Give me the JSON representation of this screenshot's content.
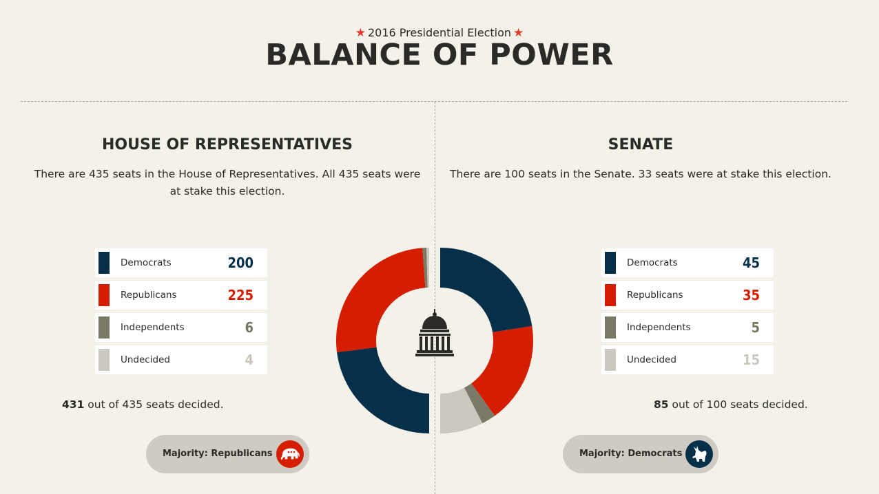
{
  "header": {
    "subtitle": "2016 Presidential Election",
    "title": "BALANCE OF POWER"
  },
  "colors": {
    "democrats": "#062f4a",
    "republicans": "#d51d00",
    "independents": "#7b7968",
    "undecided": "#cbc8bf",
    "background": "#f4f1e9"
  },
  "house": {
    "title": "HOUSE OF REPRESENTATIVES",
    "description": "There are 435 seats in the House of Representatives. All 435 seats were at stake this election.",
    "legend": [
      {
        "name": "Democrats",
        "value": "200"
      },
      {
        "name": "Republicans",
        "value": "225"
      },
      {
        "name": "Independents",
        "value": "6"
      },
      {
        "name": "Undecided",
        "value": "4"
      }
    ],
    "decided_count": "431",
    "decided_text": " out of 435 seats decided.",
    "majority": "Majority: Republicans",
    "majority_icon": "elephant-icon"
  },
  "senate": {
    "title": "SENATE",
    "description": "There are 100 seats in the Senate. 33 seats were at stake this election.",
    "legend": [
      {
        "name": "Democrats",
        "value": "45"
      },
      {
        "name": "Republicans",
        "value": "35"
      },
      {
        "name": "Independents",
        "value": "5"
      },
      {
        "name": "Undecided",
        "value": "15"
      }
    ],
    "decided_count": "85",
    "decided_text": " out of 100 seats decided.",
    "majority": "Majority: Democrats",
    "majority_icon": "donkey-icon"
  },
  "center_icon": "capitol-icon",
  "chart_data": [
    {
      "type": "pie",
      "variant": "half-donut-left",
      "title": "HOUSE OF REPRESENTATIVES",
      "categories": [
        "Democrats",
        "Republicans",
        "Independents",
        "Undecided"
      ],
      "values": [
        200,
        225,
        6,
        4
      ]
    },
    {
      "type": "pie",
      "variant": "half-donut-right",
      "title": "SENATE",
      "categories": [
        "Democrats",
        "Republicans",
        "Independents",
        "Undecided"
      ],
      "values": [
        45,
        35,
        5,
        15
      ]
    }
  ]
}
